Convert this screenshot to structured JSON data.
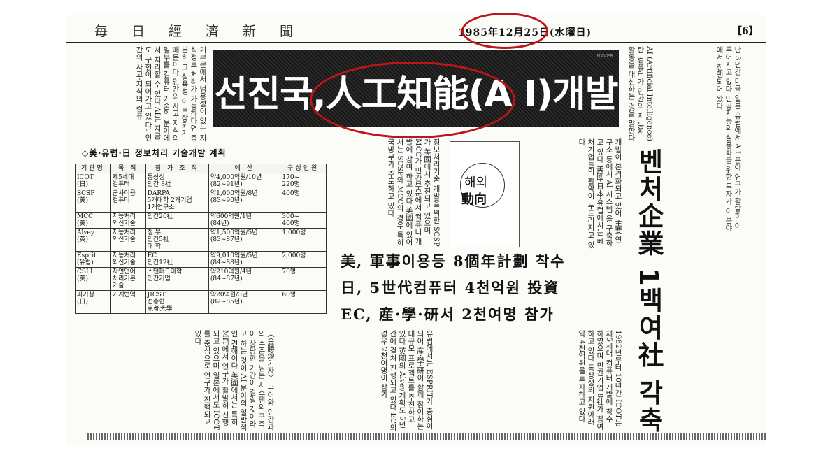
{
  "masthead": {
    "paper_name": "毎日經濟新聞",
    "date": "1985年12月25日(水曜日)",
    "page_no": "【6】"
  },
  "headline": "선진국,人工知能(A I)개발붐",
  "sidebar_headline": "벤처企業 1백여社 각축",
  "table": {
    "title": "◇美·유럽·日 정보처리 기술개발 계획",
    "columns": [
      "기관명",
      "목 적",
      "참 가 조 직",
      "예 산",
      "구성인원"
    ],
    "rows": [
      [
        "ICOT\n(日)",
        "제5세대\n컴퓨터",
        "통상성\n민간 8社",
        "약4,000억원/10년\n(82~91년)",
        "170~\n220명"
      ],
      [
        "SCSP\n(美)",
        "군사이용\n컴퓨터",
        "DARPA\n5개대학 2개기업\n1개연구소",
        "약1,000억원/8년\n(83~90년)",
        "400명"
      ],
      [
        "MCC\n(美)",
        "지능처리\n외신기술",
        "민간20社",
        "약600억원/1년\n(84년)",
        "300~\n400명"
      ],
      [
        "Alvey\n(英)",
        "지능처리\n외신기술",
        "정 부\n민간5社\n대 학",
        "약1,500억원/5년\n(83~87년)",
        "1,000명"
      ],
      [
        "Esprit\n(유럽)",
        "지능처리\n외신기술",
        "EC\n민간12社",
        "약9,010억원/5년\n(84~88년)",
        "2,000명"
      ],
      [
        "CSLI\n(美)",
        "자연언어\n처리기본\n기술",
        "스탠퍼드대학\n민간기업",
        "약210억원/4년\n(84~87년)",
        "70명"
      ],
      [
        "파기청\n(日)",
        "기계번역",
        "JICST\n전총현\n京都大學",
        "약20억원/3년\n(82~85년)",
        "60명"
      ]
    ]
  },
  "subheads": [
    "美, 軍事이용등 8個年計劃 착수",
    "日, 5世代컴퓨터 4천억원 投資",
    "EC, 産·學·研서 2천여명 참가"
  ],
  "logo": {
    "text_top": "해외",
    "text_bottom": "動向"
  },
  "byline": "〈金勝煥기자〉",
  "watermark": "NAVER",
  "body_columns": {
    "top_left": [
      "기부문에서 범용성이 있는 지식정보",
      "처리가 가능하다면 충분히 그 실용성",
      "이 보장되기 때문이다",
      "인간의 사고·지식의 일부를 컴퓨터",
      "기술의 분야에서 처리할 수 있다",
      "AI는 지금도 구현이 되어가고 있",
      "다. 인간의 사고·지식의 컴퓨"
    ],
    "top_right": [
      "AI (Artificial Intelligence)란 컴퓨터가 인간의 지",
      "능적 활동을 대신하는 것을 말한다",
      "난 3년간 미국·일본·유럽에서",
      "A I 분야 연구가 활발히 이루어지고",
      "있다 인공지능의 실용화를 위한 투자가",
      "이 분야에서 진행되어 왔다"
    ],
    "mid_left": [
      "정보처리기술 개발을 위한 SCSP가",
      "美國에서 추진되고 있으며 MCC가",
      "민간부문에서 컴퓨터 개발에 참여",
      "하고 있다",
      "美國에 있어서는 SCSP와 MCC의",
      "경우 특히 국방부가 주도하고 있다"
    ],
    "mid_right": [
      "개발이 본격화되고 있어 主要",
      "연구소 등에서 AI 시스템",
      "을 구축하고 있다",
      "美國·日本·유럽에서는",
      "벤처기업들의 활약이 두드러지고",
      "있다"
    ],
    "bottom_left": [
      "무어와 인간과의 수준을 넘는",
      "시스템의 구축이 상당한 기간이",
      "걸릴 것이라고 하는 것이",
      "AI 분야의 일반적인 견해이다",
      "美國에서는 특히 MIT에서",
      "연구가 활발히 진행되고 있으며",
      "일본에서도 ICOT를 중심으로",
      "연구가 진행되고 있다"
    ],
    "bottom_mid": [
      "유럽에서는 ESPRIT가 중심이 되어",
      "産·學·研이 함께 참여하는",
      "대규모 프로젝트를 추진하고",
      "있다 英國의 Alvey계획도",
      "5년간에 걸쳐 진행되고 있다",
      "EC의 경우 2천여명이 참가"
    ],
    "bottom_right": [
      "1982년부터 10년간 ICOT는",
      "제5세대 컴퓨터 개발에 착수",
      "하였으며 민간기업 8社가",
      "참여하고 있다 통상성의",
      "지원아래 약 4천억원을",
      "투자하고 있다"
    ]
  }
}
